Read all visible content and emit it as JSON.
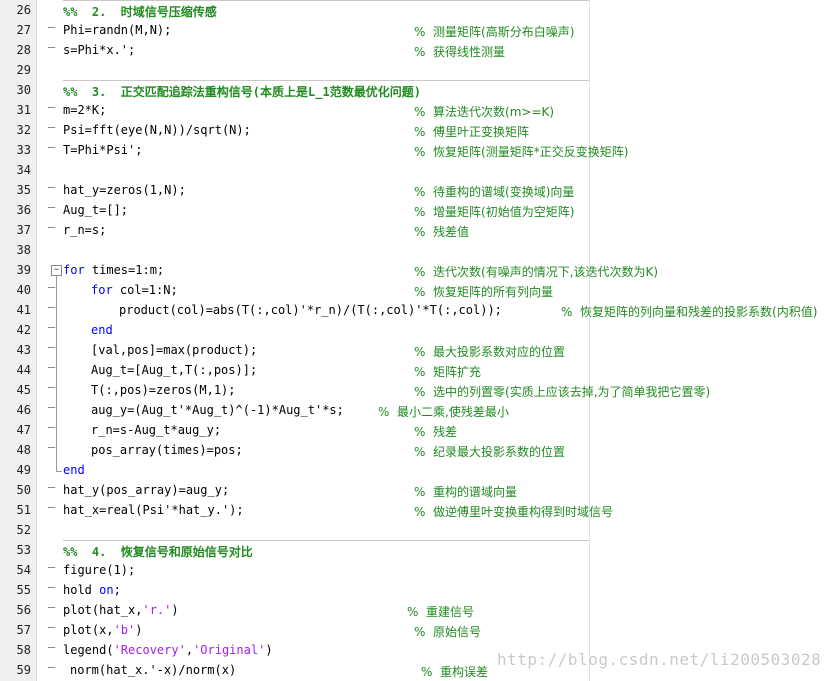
{
  "editor": {
    "lines": [
      {
        "n": "26",
        "cell": true,
        "code": "%%  2.  时域信号压缩传感"
      },
      {
        "n": "27",
        "code": "Phi=randn(M,N);",
        "comment": "%  测量矩阵(高斯分布白噪声)"
      },
      {
        "n": "28",
        "code": "s=Phi*x.';",
        "comment": "%  获得线性测量"
      },
      {
        "n": "29",
        "code": ""
      },
      {
        "n": "30",
        "cell": true,
        "code": "%%  3.  正交匹配追踪法重构信号(本质上是L_1范数最优化问题)"
      },
      {
        "n": "31",
        "code": "m=2*K;",
        "comment": "%  算法迭代次数(m>=K)"
      },
      {
        "n": "32",
        "code": "Psi=fft(eye(N,N))/sqrt(N);",
        "comment": "%  傅里叶正变换矩阵"
      },
      {
        "n": "33",
        "code": "T=Phi*Psi';",
        "comment": "%  恢复矩阵(测量矩阵*正交反变换矩阵)"
      },
      {
        "n": "34",
        "code": ""
      },
      {
        "n": "35",
        "code": "hat_y=zeros(1,N);",
        "comment": "%  待重构的谱域(变换域)向量"
      },
      {
        "n": "36",
        "code": "Aug_t=[];",
        "comment": "%  增量矩阵(初始值为空矩阵)"
      },
      {
        "n": "37",
        "code": "r_n=s;",
        "comment": "%  残差值"
      },
      {
        "n": "38",
        "code": ""
      },
      {
        "n": "39",
        "kw": "for",
        "code": " times=1:m;",
        "comment": "%  迭代次数(有噪声的情况下,该迭代次数为K)"
      },
      {
        "n": "40",
        "kw": "for",
        "code": " col=1:N;",
        "comment": "%  恢复矩阵的所有列向量"
      },
      {
        "n": "41",
        "code": "product(col)=abs(T(:,col)'*r_n)/(T(:,col)'*T(:,col));",
        "comment": "%  恢复矩阵的列向量和残差的投影系数(内积值)"
      },
      {
        "n": "42",
        "kw": "end",
        "code": ""
      },
      {
        "n": "43",
        "code": "[val,pos]=max(product);",
        "comment": "%  最大投影系数对应的位置"
      },
      {
        "n": "44",
        "code": "Aug_t=[Aug_t,T(:,pos)];",
        "comment": "%  矩阵扩充"
      },
      {
        "n": "45",
        "code": "T(:,pos)=zeros(M,1);",
        "comment": "%  选中的列置零(实质上应该去掉,为了简单我把它置零)"
      },
      {
        "n": "46",
        "code": "aug_y=(Aug_t'*Aug_t)^(-1)*Aug_t'*s;",
        "comment": "%  最小二乘,使残差最小"
      },
      {
        "n": "47",
        "code": "r_n=s-Aug_t*aug_y;",
        "comment": "%  残差"
      },
      {
        "n": "48",
        "code": "pos_array(times)=pos;",
        "comment": "%  纪录最大投影系数的位置"
      },
      {
        "n": "49",
        "kw": "end",
        "code": ""
      },
      {
        "n": "50",
        "code": "hat_y(pos_array)=aug_y;",
        "comment": "%  重构的谱域向量"
      },
      {
        "n": "51",
        "code": "hat_x=real(Psi'*hat_y.');",
        "comment": "%  做逆傅里叶变换重构得到时域信号"
      },
      {
        "n": "52",
        "code": ""
      },
      {
        "n": "53",
        "cell": true,
        "code": "%%  4.  恢复信号和原始信号对比"
      },
      {
        "n": "54",
        "code": "figure(1);"
      },
      {
        "n": "55",
        "code": "hold on;"
      },
      {
        "n": "56",
        "code": "plot(hat_x,'r.')",
        "comment": "%  重建信号"
      },
      {
        "n": "57",
        "code": "plot(x,'b')",
        "comment": "%  原始信号"
      },
      {
        "n": "58",
        "code": "legend('Recovery','Original')"
      },
      {
        "n": "59",
        "code": "norm(hat_x.'-x)/norm(x)",
        "comment": "%  重构误差"
      }
    ]
  },
  "watermark": "http://blog.csdn.net/li200503028"
}
